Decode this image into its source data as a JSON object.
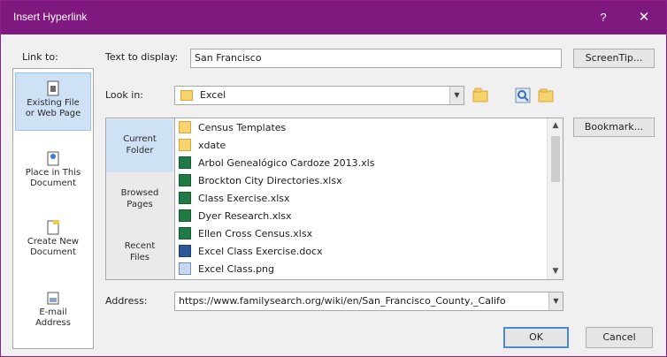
{
  "window": {
    "title": "Insert Hyperlink",
    "help_glyph": "?",
    "close_glyph": "✕"
  },
  "labels": {
    "link_to": "Link to:",
    "text_to_display": "Text to display:",
    "look_in": "Look in:",
    "address": "Address:"
  },
  "text_to_display_value": "San Francisco",
  "look_in_value": "Excel",
  "address_value": "https://www.familysearch.org/wiki/en/San_Francisco_County,_Califo",
  "buttons": {
    "screentip": "ScreenTip...",
    "bookmark": "Bookmark...",
    "ok": "OK",
    "cancel": "Cancel"
  },
  "link_to_items": [
    {
      "line1": "Existing File",
      "line2": "or Web Page",
      "icon": "existing-file-icon",
      "selected": true
    },
    {
      "line1": "Place in This",
      "line2": "Document",
      "icon": "place-in-document-icon",
      "selected": false
    },
    {
      "line1": "Create New",
      "line2": "Document",
      "icon": "create-new-document-icon",
      "selected": false
    },
    {
      "line1": "E-mail",
      "line2": "Address",
      "icon": "email-address-icon",
      "selected": false
    }
  ],
  "side_tabs": [
    {
      "line1": "Current",
      "line2": "Folder",
      "selected": true
    },
    {
      "line1": "Browsed",
      "line2": "Pages",
      "selected": false
    },
    {
      "line1": "Recent",
      "line2": "Files",
      "selected": false
    }
  ],
  "files": [
    {
      "name": "Census Templates",
      "type": "folder"
    },
    {
      "name": "xdate",
      "type": "folder"
    },
    {
      "name": "Arbol Genealógico Cardoze 2013.xls",
      "type": "xls"
    },
    {
      "name": "Brockton City Directories.xlsx",
      "type": "xls"
    },
    {
      "name": "Class Exercise.xlsx",
      "type": "xls"
    },
    {
      "name": "Dyer Research.xlsx",
      "type": "xls"
    },
    {
      "name": "Ellen Cross Census.xlsx",
      "type": "xls"
    },
    {
      "name": "Excel Class Exercise.docx",
      "type": "doc"
    },
    {
      "name": "Excel Class.png",
      "type": "png"
    }
  ],
  "colors": {
    "titlebar": "#80197f",
    "selection": "#cfe2f5",
    "default_button_border": "#4a8ad8"
  }
}
